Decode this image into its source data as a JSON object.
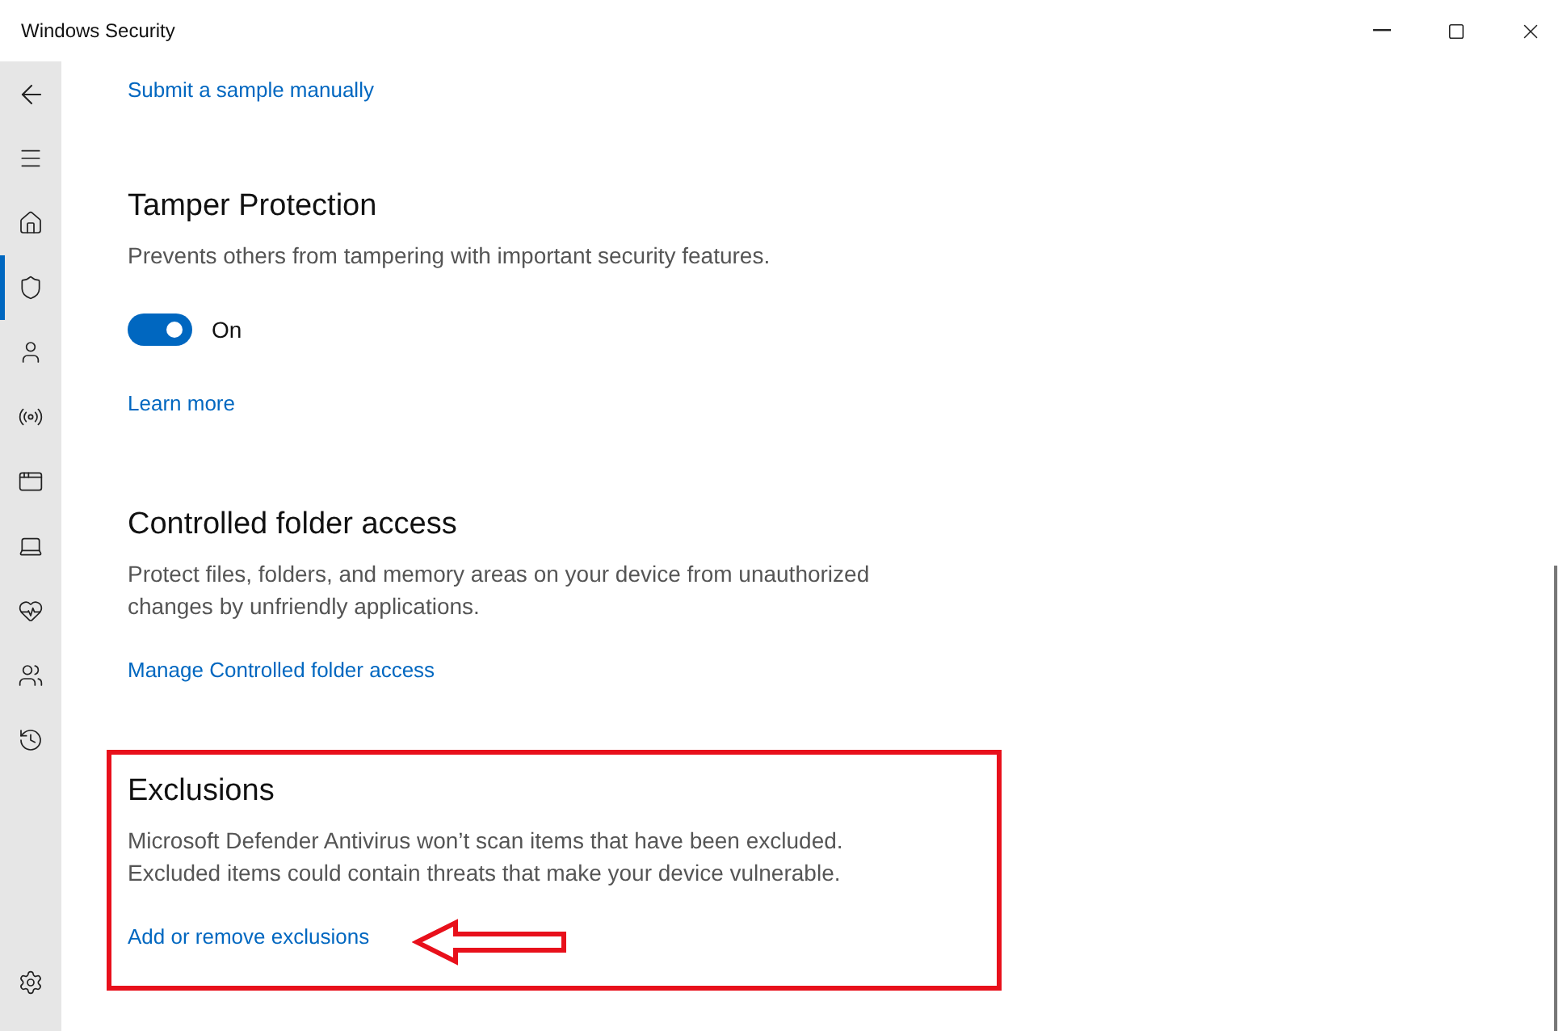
{
  "window": {
    "title": "Windows Security"
  },
  "sidebar": {
    "items": [
      {
        "kind": "back",
        "selected": false
      },
      {
        "kind": "menu",
        "selected": false
      },
      {
        "kind": "home",
        "selected": false
      },
      {
        "kind": "shield",
        "selected": true
      },
      {
        "kind": "account",
        "selected": false
      },
      {
        "kind": "network",
        "selected": false
      },
      {
        "kind": "app",
        "selected": false
      },
      {
        "kind": "device",
        "selected": false
      },
      {
        "kind": "health",
        "selected": false
      },
      {
        "kind": "family",
        "selected": false
      },
      {
        "kind": "history",
        "selected": false
      }
    ],
    "bottom_item": {
      "kind": "settings",
      "selected": false
    }
  },
  "top_link": "Submit a sample manually",
  "sections": [
    {
      "title": "Tamper Protection",
      "description": "Prevents others from tampering with important security features.",
      "toggle": {
        "on": true,
        "label": "On"
      },
      "link": "Learn more"
    },
    {
      "title": "Controlled folder access",
      "description": "Protect files, folders, and memory areas on your device from unauthorized changes by unfriendly applications.",
      "link": "Manage Controlled folder access"
    },
    {
      "title": "Exclusions",
      "description": "Microsoft Defender Antivirus won’t scan items that have been excluded. Excluded items could contain threats that make your device vulnerable.",
      "link": "Add or remove exclusions",
      "highlighted": true
    }
  ]
}
